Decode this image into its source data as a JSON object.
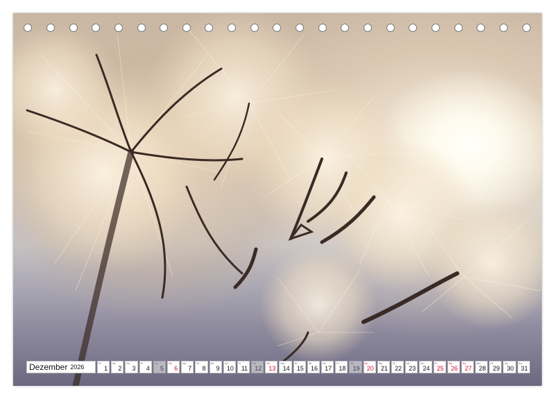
{
  "calendar": {
    "month": "Dezember",
    "year": "2026",
    "days": [
      {
        "num": "1",
        "wd": "Di",
        "weekend": false
      },
      {
        "num": "2",
        "wd": "Mi",
        "weekend": false
      },
      {
        "num": "3",
        "wd": "Do",
        "weekend": false
      },
      {
        "num": "4",
        "wd": "Fr",
        "weekend": false
      },
      {
        "num": "5",
        "wd": "Sa",
        "weekend": false,
        "faded": true
      },
      {
        "num": "6",
        "wd": "So",
        "weekend": true
      },
      {
        "num": "7",
        "wd": "Mo",
        "weekend": false
      },
      {
        "num": "8",
        "wd": "Di",
        "weekend": false
      },
      {
        "num": "9",
        "wd": "Mi",
        "weekend": false
      },
      {
        "num": "10",
        "wd": "Do",
        "weekend": false
      },
      {
        "num": "11",
        "wd": "Fr",
        "weekend": false
      },
      {
        "num": "12",
        "wd": "Sa",
        "weekend": false,
        "faded": true
      },
      {
        "num": "13",
        "wd": "So",
        "weekend": true
      },
      {
        "num": "14",
        "wd": "Mo",
        "weekend": false
      },
      {
        "num": "15",
        "wd": "Di",
        "weekend": false
      },
      {
        "num": "16",
        "wd": "Mi",
        "weekend": false
      },
      {
        "num": "17",
        "wd": "Do",
        "weekend": false
      },
      {
        "num": "18",
        "wd": "Fr",
        "weekend": false
      },
      {
        "num": "19",
        "wd": "Sa",
        "weekend": false,
        "faded": true
      },
      {
        "num": "20",
        "wd": "So",
        "weekend": true
      },
      {
        "num": "21",
        "wd": "Mo",
        "weekend": false
      },
      {
        "num": "22",
        "wd": "Di",
        "weekend": false
      },
      {
        "num": "23",
        "wd": "Mi",
        "weekend": false
      },
      {
        "num": "24",
        "wd": "Do",
        "weekend": false
      },
      {
        "num": "25",
        "wd": "Fr",
        "weekend": true
      },
      {
        "num": "26",
        "wd": "Sa",
        "weekend": true
      },
      {
        "num": "27",
        "wd": "So",
        "weekend": true
      },
      {
        "num": "28",
        "wd": "Mo",
        "weekend": false
      },
      {
        "num": "29",
        "wd": "Di",
        "weekend": false
      },
      {
        "num": "30",
        "wd": "Mi",
        "weekend": false
      },
      {
        "num": "31",
        "wd": "Do",
        "weekend": false
      }
    ]
  },
  "colors": {
    "weekend": "#c8102e",
    "text": "#111111"
  },
  "photo": {
    "subject": "dandelion-seeds-backlit"
  }
}
